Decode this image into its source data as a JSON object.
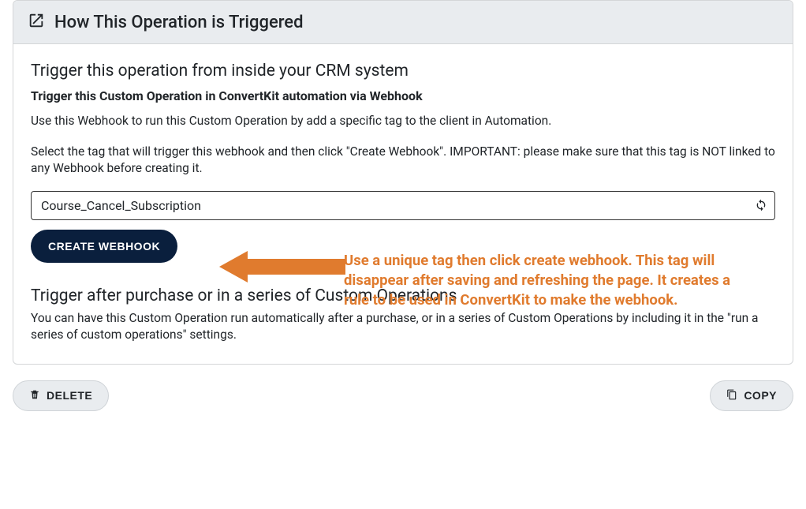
{
  "panel": {
    "title": "How This Operation is Triggered"
  },
  "section1": {
    "heading": "Trigger this operation from inside your CRM system",
    "bold": "Trigger this Custom Operation in ConvertKit automation via Webhook",
    "desc1": "Use this Webhook to run this Custom Operation by add a specific tag to the client in Automation.",
    "desc2": "Select the tag that will trigger this webhook and then click \"Create Webhook\". IMPORTANT: please make sure that this tag is NOT linked to any Webhook before creating it."
  },
  "tag_input": {
    "value": "Course_Cancel_Subscription"
  },
  "buttons": {
    "create": "CREATE WEBHOOK",
    "delete": "DELETE",
    "copy": "COPY"
  },
  "section2": {
    "heading": "Trigger after purchase or in a series of Custom Operations",
    "desc": "You can have this Custom Operation run automatically after a purchase, or in a series of Custom Operations by including it in the \"run a series of custom operations\" settings."
  },
  "annotation": {
    "text": "Use a unique tag then click create webhook. This tag will disappear after saving and refreshing the page. It creates a rule to be used in ConvertKit to make the webhook.",
    "color": "#e07b2e"
  }
}
